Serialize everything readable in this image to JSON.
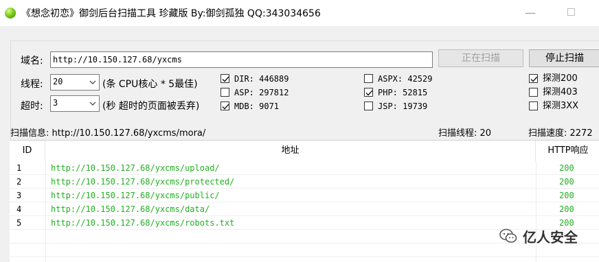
{
  "window": {
    "title": "《想念初恋》御剑后台扫描工具 珍藏版 By:御剑孤独 QQ:343034656",
    "minimize_glyph": "—",
    "icon": "green-orb-icon"
  },
  "form": {
    "domain_label": "域名:",
    "domain_value": "http://10.150.127.68/yxcms",
    "threads_label": "线程:",
    "threads_value": "20",
    "threads_hint": "(条 CPU核心 * 5最佳)",
    "timeout_label": "超时:",
    "timeout_value": "3",
    "timeout_hint": "(秒 超时的页面被丢弃)",
    "scan_button": "正在扫描",
    "stop_button": "停止扫描"
  },
  "dictionaries": [
    {
      "label": "DIR: 446889",
      "checked": true
    },
    {
      "label": "ASP: 297812",
      "checked": false
    },
    {
      "label": "MDB: 9071",
      "checked": true
    },
    {
      "label": "ASPX: 42529",
      "checked": false
    },
    {
      "label": "PHP: 52815",
      "checked": true
    },
    {
      "label": "JSP: 19739",
      "checked": false
    }
  ],
  "detect": [
    {
      "label": "探测200",
      "checked": true
    },
    {
      "label": "探测403",
      "checked": false
    },
    {
      "label": "探测3XX",
      "checked": false
    }
  ],
  "status": {
    "info": "扫描信息: http://10.150.127.68/yxcms/mora/",
    "threads": "扫描线程: 20",
    "speed": "扫描速度: 2272"
  },
  "table": {
    "columns": [
      "ID",
      "地址",
      "HTTP响应"
    ],
    "rows": [
      {
        "id": "1",
        "url": "http://10.150.127.68/yxcms/upload/",
        "code": "200"
      },
      {
        "id": "2",
        "url": "http://10.150.127.68/yxcms/protected/",
        "code": "200"
      },
      {
        "id": "3",
        "url": "http://10.150.127.68/yxcms/public/",
        "code": "200"
      },
      {
        "id": "4",
        "url": "http://10.150.127.68/yxcms/data/",
        "code": "200"
      },
      {
        "id": "5",
        "url": "http://10.150.127.68/yxcms/robots.txt",
        "code": "200"
      }
    ]
  },
  "watermark": {
    "text": "亿人安全",
    "icon": "wechat-icon"
  },
  "colors": {
    "result_green": "#22b022",
    "panel": "#f0f0f0"
  }
}
